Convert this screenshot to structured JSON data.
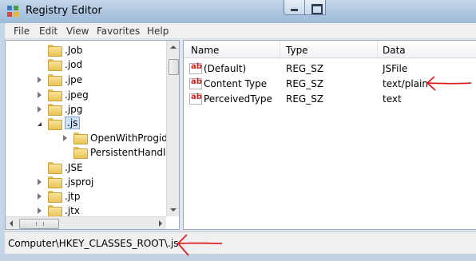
{
  "window": {
    "title": "Registry Editor"
  },
  "menu": [
    "File",
    "Edit",
    "View",
    "Favorites",
    "Help"
  ],
  "tree": {
    "items": [
      {
        "label": ".Job",
        "expandable": false,
        "level": 0
      },
      {
        "label": ".jod",
        "expandable": false,
        "level": 0
      },
      {
        "label": ".jpe",
        "expandable": true,
        "level": 0
      },
      {
        "label": ".jpeg",
        "expandable": true,
        "level": 0
      },
      {
        "label": ".jpg",
        "expandable": true,
        "level": 0
      },
      {
        "label": ".js",
        "expandable": true,
        "expanded": true,
        "selected": true,
        "level": 0
      },
      {
        "label": "OpenWithProgids",
        "expandable": true,
        "level": 1
      },
      {
        "label": "PersistentHandler",
        "expandable": false,
        "level": 1
      },
      {
        "label": ".JSE",
        "expandable": false,
        "level": 0
      },
      {
        "label": ".jsproj",
        "expandable": true,
        "level": 0
      },
      {
        "label": ".jtp",
        "expandable": true,
        "level": 0
      },
      {
        "label": ".jtx",
        "expandable": true,
        "level": 0
      }
    ]
  },
  "list": {
    "columns": [
      "Name",
      "Type",
      "Data"
    ],
    "rows": [
      {
        "name": "(Default)",
        "type": "REG_SZ",
        "data": "JSFile"
      },
      {
        "name": "Content Type",
        "type": "REG_SZ",
        "data": "text/plain"
      },
      {
        "name": "PerceivedType",
        "type": "REG_SZ",
        "data": "text"
      }
    ]
  },
  "status": {
    "path": "Computer\\HKEY_CLASSES_ROOT\\.js"
  },
  "icons": {
    "value": "ab-string-icon",
    "folder": "folder-icon",
    "app": "registry-editor-icon"
  },
  "colors": {
    "annotation": "#e02020",
    "selection": "#cde3f7"
  }
}
